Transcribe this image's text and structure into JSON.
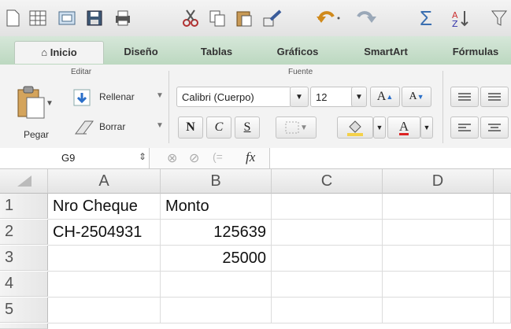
{
  "toolbar": {
    "icons": [
      "new-doc-icon",
      "template-icon",
      "open-icon",
      "save-icon",
      "print-icon",
      "cut-icon",
      "copy-icon",
      "paste-icon",
      "format-painter-icon",
      "undo-icon",
      "redo-icon",
      "autosum-icon",
      "sort-icon",
      "filter-icon"
    ],
    "undo_sep": "·",
    "sum_symbol": "Σ"
  },
  "tabs": [
    {
      "label": "Inicio",
      "active": true
    },
    {
      "label": "Diseño",
      "active": false
    },
    {
      "label": "Tablas",
      "active": false
    },
    {
      "label": "Gráficos",
      "active": false
    },
    {
      "label": "SmartArt",
      "active": false
    },
    {
      "label": "Fórmulas",
      "active": false
    }
  ],
  "ribbon": {
    "editar_title": "Editar",
    "fuente_title": "Fuente",
    "paste_label": "Pegar",
    "fill_label": "Rellenar",
    "clear_label": "Borrar",
    "font_name": "Calibri (Cuerpo)",
    "font_size": "12",
    "grow_font": "A",
    "shrink_font": "A",
    "bold": "N",
    "italic": "C",
    "underline": "S",
    "font_color_letter": "A"
  },
  "formula_bar": {
    "name_box": "G9",
    "fx": "fx",
    "value": ""
  },
  "sheet": {
    "columns": [
      "A",
      "B",
      "C",
      "D"
    ],
    "rows": [
      "1",
      "2",
      "3",
      "4",
      "5"
    ],
    "cells": {
      "A1": "Nro Cheque",
      "B1": "Monto",
      "A2": "CH-2504931",
      "B2": "125639",
      "B3": "25000"
    }
  },
  "colors": {
    "accent": "#bcd8c0",
    "font_color_underline": "#d22"
  }
}
